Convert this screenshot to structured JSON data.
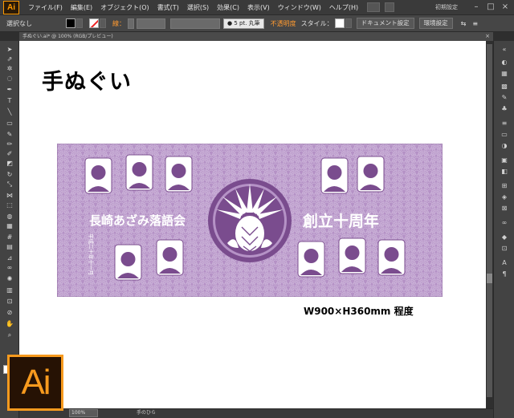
{
  "app": {
    "badge": "Ai",
    "workspace_label": "初期設定",
    "menu": [
      "ファイル(F)",
      "編集(E)",
      "オブジェクト(O)",
      "書式(T)",
      "選択(S)",
      "効果(C)",
      "表示(V)",
      "ウィンドウ(W)",
      "ヘルプ(H)"
    ],
    "win_buttons": [
      "–",
      "□",
      "×"
    ]
  },
  "control_bar": {
    "selection": "選択なし",
    "stroke_label": "線：",
    "brush": "● 5 pt. 丸筆",
    "opacity_label": "不透明度",
    "style_label": "スタイル：",
    "doc_settings": "ドキュメント設定",
    "env_settings": "環境設定"
  },
  "tab": {
    "name": "手ぬぐい.ai* @ 100% (RGB/プレビュー)",
    "close": "×"
  },
  "artboard": {
    "title": "手ぬぐい",
    "size_label": "W900×H360mm 程度"
  },
  "towel": {
    "org_name": "長崎あざみ落語会",
    "anniversary": "創立十周年",
    "date_text": "平成二十年十一月",
    "colors": {
      "bg": "#b592c6",
      "wave": "#c9afd6",
      "emblem": "#7a4c8e",
      "text": "#ffffff"
    }
  },
  "status": {
    "zoom": "100%",
    "tool_name": "手のひら"
  },
  "logo": {
    "text": "Ai",
    "color": "#f79a1e"
  }
}
